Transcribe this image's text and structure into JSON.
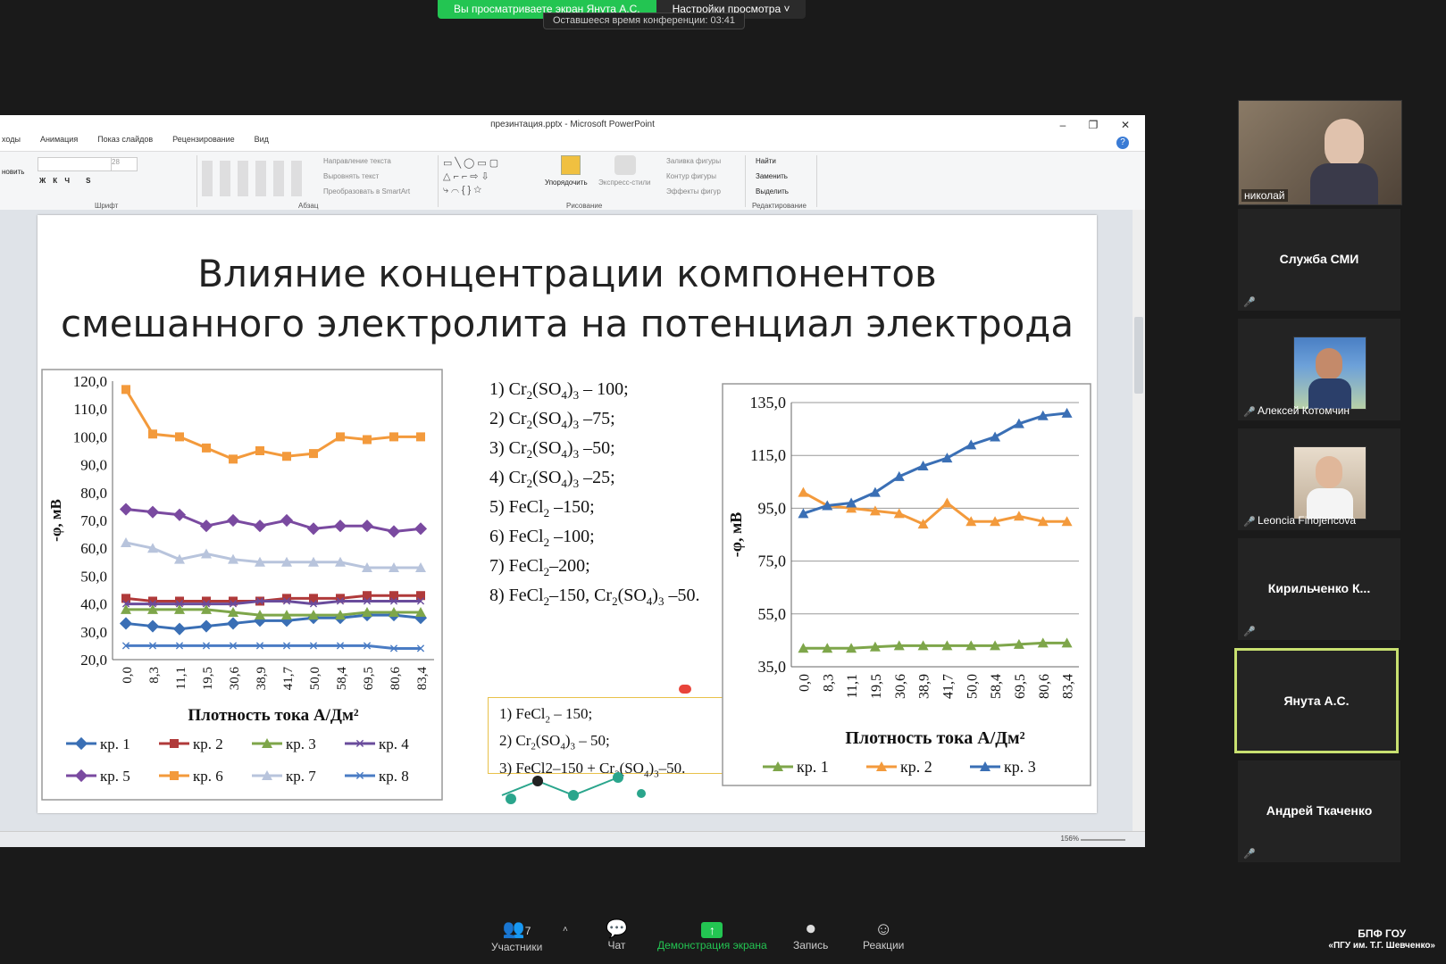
{
  "banner": {
    "viewing_text": "Вы просматриваете экран Янута А.С.",
    "view_settings": "Настройки просмотра",
    "timer_text": "Оставшееся время конференции: 03:41"
  },
  "ppt": {
    "window_title": "презинтация.pptx - Microsoft PowerPoint",
    "tabs": [
      "ходы",
      "Анимация",
      "Показ слайдов",
      "Рецензирование",
      "Вид"
    ],
    "groups": [
      "Шрифт",
      "Абзац",
      "Рисование",
      "Редактирование"
    ],
    "ribbon_items": {
      "text_direction": "Направление текста",
      "align_text": "Выровнять текст",
      "smartart": "Преобразовать в SmartArt",
      "arrange": "Упорядочить",
      "quick_styles": "Экспресс-стили",
      "shape_fill": "Заливка фигуры",
      "shape_outline": "Контур фигуры",
      "shape_effects": "Эффекты фигур",
      "find": "Найти",
      "replace": "Заменить",
      "select": "Выделить",
      "restore": "новить",
      "font_size": "28"
    },
    "zoom": "156%"
  },
  "slide": {
    "title_line1": "Влияние концентрации компонентов",
    "title_line2": "смешанного электролита на потенциал электрода",
    "legend_lines": [
      {
        "pre": "1) Cr",
        "s1": "2",
        "mid": "(SO",
        "s2": "4",
        "post": ")",
        "s3": "3",
        "tail": " – 100;"
      },
      {
        "pre": "2) Cr",
        "s1": "2",
        "mid": "(SO",
        "s2": "4",
        "post": ")",
        "s3": "3",
        "tail": " –75;"
      },
      {
        "pre": "3) Cr",
        "s1": "2",
        "mid": "(SO",
        "s2": "4",
        "post": ")",
        "s3": "3",
        "tail": " –50;"
      },
      {
        "pre": "4) Cr",
        "s1": "2",
        "mid": "(SO",
        "s2": "4",
        "post": ")",
        "s3": "3",
        "tail": " –25;"
      }
    ],
    "fecl_lines": [
      {
        "pre": "5) FeCl",
        "s1": "2",
        "tail": "  –150;"
      },
      {
        "pre": "6) FeCl",
        "s1": "2",
        "tail": " –100;"
      },
      {
        "pre": "7) FeCl",
        "s1": "2",
        "tail": "–200;"
      }
    ],
    "line8": {
      "a": "8) FeCl",
      "s1": "2",
      "b": "–150, Cr",
      "s2": "2",
      "c": "(SO",
      "s3": "4",
      "d": ")",
      "s4": "3",
      "e": " –50."
    },
    "box_lines": [
      {
        "a": "1)   FeCl",
        "s1": "2",
        "b": " – 150;"
      },
      {
        "a": "2)  Cr",
        "s1": "2",
        "b": "(SO",
        "s2": "4",
        "c": ")",
        "s3": "3",
        "d": " – 50;"
      },
      {
        "a": "3) FeCl2–150 + Cr",
        "s1": "2",
        "b": "(SO",
        "s2": "4",
        "c": ")",
        "s3": "3",
        "d": "–50."
      }
    ]
  },
  "chart_data": [
    {
      "type": "line",
      "xlabel": "Плотность тока А/Дм²",
      "ylabel": "-φ, мВ",
      "x": [
        "0,0",
        "8,3",
        "11,1",
        "19,5",
        "30,6",
        "38,9",
        "41,7",
        "50,0",
        "58,4",
        "69,5",
        "80,6",
        "83,4"
      ],
      "y_ticks": [
        "20,0",
        "30,0",
        "40,0",
        "50,0",
        "60,0",
        "70,0",
        "80,0",
        "90,0",
        "100,0",
        "110,0",
        "120,0"
      ],
      "ylim": [
        20,
        120
      ],
      "series": [
        {
          "name": "кр. 1",
          "color": "#3a6fb5",
          "values": [
            33,
            32,
            31,
            32,
            33,
            34,
            34,
            35,
            35,
            36,
            36,
            35
          ]
        },
        {
          "name": "кр. 2",
          "color": "#b03a3a",
          "values": [
            42,
            41,
            41,
            41,
            41,
            41,
            42,
            42,
            42,
            43,
            43,
            43
          ]
        },
        {
          "name": "кр. 3",
          "color": "#7ea64a",
          "values": [
            38,
            38,
            38,
            38,
            37,
            36,
            36,
            36,
            36,
            37,
            37,
            37
          ]
        },
        {
          "name": "кр. 4",
          "color": "#6a4c9c",
          "values": [
            40,
            40,
            40,
            40,
            40,
            41,
            41,
            40,
            41,
            41,
            41,
            41
          ]
        },
        {
          "name": "кр. 5",
          "color": "#7a4aa0",
          "values": [
            74,
            73,
            72,
            68,
            70,
            68,
            70,
            67,
            68,
            68,
            66,
            67
          ]
        },
        {
          "name": "кр. 6",
          "color": "#f39a3c",
          "values": [
            117,
            101,
            100,
            96,
            92,
            95,
            93,
            94,
            100,
            99,
            100,
            100
          ]
        },
        {
          "name": "кр. 7",
          "color": "#b8c4dc",
          "values": [
            62,
            60,
            56,
            58,
            56,
            55,
            55,
            55,
            55,
            53,
            53,
            53
          ]
        },
        {
          "name": "кр. 8",
          "color": "#4a7cc4",
          "values": [
            25,
            25,
            25,
            25,
            25,
            25,
            25,
            25,
            25,
            25,
            24,
            24
          ]
        }
      ]
    },
    {
      "type": "line",
      "xlabel": "Плотность тока А/Дм²",
      "ylabel": "-φ, мВ",
      "x": [
        "0,0",
        "8,3",
        "11,1",
        "19,5",
        "30,6",
        "38,9",
        "41,7",
        "50,0",
        "58,4",
        "69,5",
        "80,6",
        "83,4"
      ],
      "y_ticks": [
        "35,0",
        "55,0",
        "75,0",
        "95,0",
        "115,0",
        "135,0"
      ],
      "ylim": [
        35,
        135
      ],
      "series": [
        {
          "name": "кр. 1",
          "color": "#7ea64a",
          "values": [
            42,
            42,
            42,
            42.5,
            43,
            43,
            43,
            43,
            43,
            43.5,
            44,
            44
          ]
        },
        {
          "name": "кр. 2",
          "color": "#f39a3c",
          "values": [
            101,
            96,
            95,
            94,
            93,
            89,
            97,
            90,
            90,
            92,
            90,
            90
          ]
        },
        {
          "name": "кр. 3",
          "color": "#3a6fb5",
          "values": [
            93,
            96,
            97,
            101,
            107,
            111,
            114,
            119,
            122,
            127,
            130,
            131
          ]
        }
      ]
    }
  ],
  "participants": [
    {
      "name": "николай",
      "type": "video"
    },
    {
      "name": "Служба СМИ",
      "type": "name"
    },
    {
      "name": "Алексей Котомчин",
      "type": "photo"
    },
    {
      "name": "Leoncia Finojencova",
      "type": "photo"
    },
    {
      "name": "Кирильченко  К...",
      "type": "name"
    },
    {
      "name": "Янута А.С.",
      "type": "name"
    },
    {
      "name": "Андрей Ткаченко",
      "type": "name"
    }
  ],
  "toolbar": {
    "participants_label": "Участники",
    "participants_count": "7",
    "chat_label": "Чат",
    "share_label": "Демонстрация экрана",
    "record_label": "Запись",
    "reactions_label": "Реакции"
  },
  "brand": {
    "line1": "БПФ ГОУ",
    "line2": "«ПГУ им. Т.Г. Шевченко»"
  }
}
